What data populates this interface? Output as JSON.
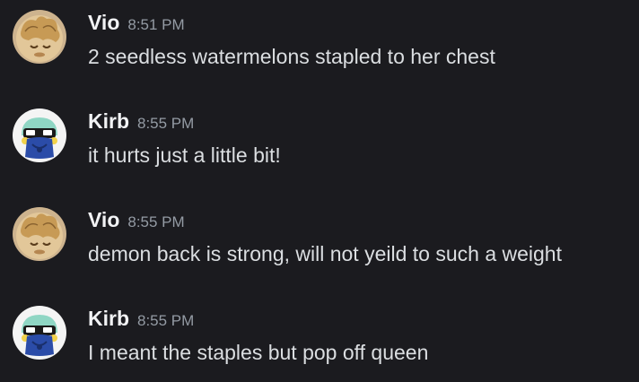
{
  "colors": {
    "background": "#1b1b1f",
    "username": "#f2f3f5",
    "timestamp": "#949ba4",
    "message_text": "#dbdee1"
  },
  "messages": [
    {
      "author": "Vio",
      "time": "8:51 PM",
      "text": "2 seedless watermelons stapled to her chest",
      "avatar_icon": "vio-avatar-icon"
    },
    {
      "author": "Kirb",
      "time": "8:55 PM",
      "text": "it hurts just a little bit!",
      "avatar_icon": "kirb-avatar-icon"
    },
    {
      "author": "Vio",
      "time": "8:55 PM",
      "text": "demon back is strong, will not yeild to such a weight",
      "avatar_icon": "vio-avatar-icon"
    },
    {
      "author": "Kirb",
      "time": "8:55 PM",
      "text": "I meant the staples but pop off queen",
      "avatar_icon": "kirb-avatar-icon"
    }
  ]
}
